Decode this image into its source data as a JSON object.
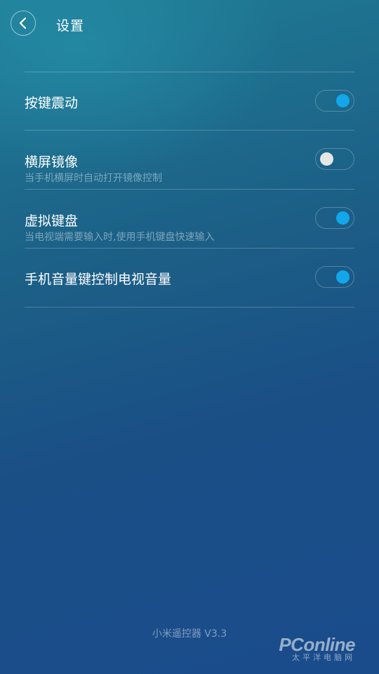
{
  "header": {
    "title": "设置",
    "back_icon": "chevron-left-icon"
  },
  "settings": [
    {
      "title": "按键震动",
      "subtitle": "",
      "enabled": true
    },
    {
      "title": "横屏镜像",
      "subtitle": "当手机横屏时自动打开镜像控制",
      "enabled": false
    },
    {
      "title": "虚拟键盘",
      "subtitle": "当电视端需要输入时,使用手机键盘快速输入",
      "enabled": true
    },
    {
      "title": "手机音量键控制电视音量",
      "subtitle": "",
      "enabled": true
    }
  ],
  "footer": {
    "version": "小米遥控器 V3.3"
  },
  "watermark": {
    "main": "PConline",
    "sub": "太平洋电脑网"
  },
  "colors": {
    "toggle_on": "#12a6ea",
    "toggle_off": "#e6e6e6"
  }
}
